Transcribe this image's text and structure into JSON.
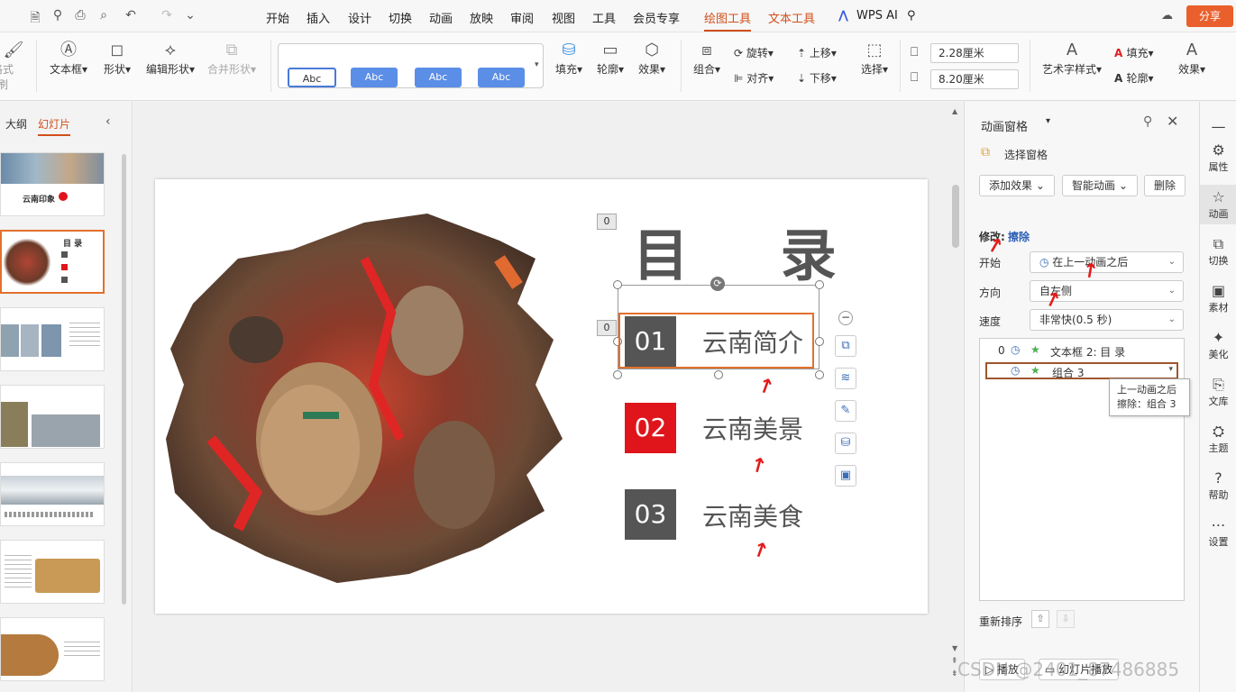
{
  "menu": {
    "items": [
      "开始",
      "插入",
      "设计",
      "切换",
      "动画",
      "放映",
      "审阅",
      "视图",
      "工具",
      "会员专享",
      "绘图工具",
      "文本工具",
      "WPS AI"
    ],
    "share": "分享"
  },
  "ribbon": {
    "format_painter": "格式刷",
    "textbox": "文本框",
    "shape": "形状",
    "edit_shape": "编辑形状",
    "merge_shape": "合并形状",
    "styles": [
      "Abc",
      "Abc",
      "Abc",
      "Abc"
    ],
    "fill": "填充",
    "outline": "轮廓",
    "effect": "效果",
    "group": "组合",
    "rotate": "旋转",
    "align": "对齐",
    "move_up": "上移",
    "move_down": "下移",
    "select": "选择",
    "height": "2.28厘米",
    "width": "8.20厘米",
    "art_style": "艺术字样式",
    "text_fill": "填充",
    "text_outline": "轮廓",
    "text_effect": "效果"
  },
  "left": {
    "tab_outline": "大纲",
    "tab_slides": "幻灯片",
    "thumb1_title": "云南印象",
    "thumb2_title": "目 录"
  },
  "slide": {
    "title": "目 录",
    "anim_badge_title": "0",
    "anim_badge_item": "0",
    "items": [
      {
        "num": "01",
        "label": "云南简介"
      },
      {
        "num": "02",
        "label": "云南美景"
      },
      {
        "num": "03",
        "label": "云南美食"
      }
    ],
    "num_colors": [
      "#555555",
      "#e0151c",
      "#555555"
    ]
  },
  "anim": {
    "title": "动画窗格",
    "selection_pane": "选择窗格",
    "add_effect": "添加效果",
    "smart_anim": "智能动画",
    "delete": "删除",
    "modify_label": "修改:",
    "modify_value": "擦除",
    "start_label": "开始",
    "start_value": "在上一动画之后",
    "direction_label": "方向",
    "direction_value": "自左侧",
    "speed_label": "速度",
    "speed_value": "非常快(0.5 秒)",
    "list": [
      {
        "idx": "0",
        "text": "文本框 2: 目 录"
      },
      {
        "idx": "",
        "text": "组合 3"
      }
    ],
    "tooltip_line1": "上一动画之后",
    "tooltip_line2": "擦除：组合 3",
    "reorder": "重新排序",
    "play": "播放",
    "slideshow": "幻灯片播放"
  },
  "rightbar": [
    "属性",
    "动画",
    "切换",
    "素材",
    "美化",
    "文库",
    "主题",
    "帮助",
    "设置"
  ],
  "watermark": "CSDN @2401_87486885"
}
